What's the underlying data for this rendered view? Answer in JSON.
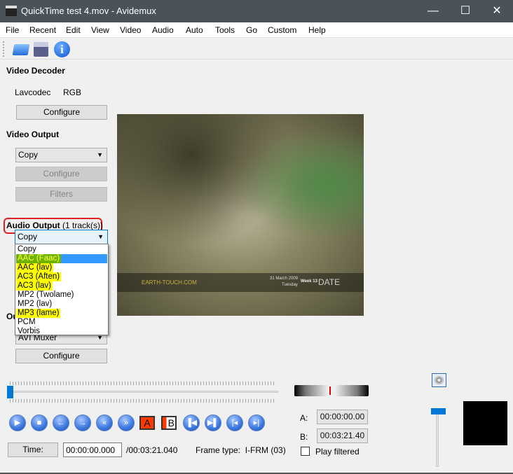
{
  "window": {
    "title": "QuickTime test 4.mov - Avidemux",
    "minimize": "—",
    "maximize": "☐",
    "close": "✕"
  },
  "menu": [
    "File",
    "Recent",
    "Edit",
    "View",
    "Video",
    "Audio",
    "Auto",
    "Tools",
    "Go",
    "Custom",
    "Help"
  ],
  "toolbar": {
    "icons": [
      "open-folder-icon",
      "save-disk-icon",
      "info-icon"
    ]
  },
  "video_decoder": {
    "heading": "Video Decoder",
    "codec": "Lavcodec",
    "format": "RGB",
    "configure": "Configure"
  },
  "video_output": {
    "heading": "Video Output",
    "selected": "Copy",
    "configure": "Configure",
    "filters": "Filters"
  },
  "audio_output": {
    "heading": "Audio Output",
    "tracks": "(1 track(s))",
    "selected": "Copy",
    "options": [
      "Copy",
      "AAC (Faac)",
      "AAC (lav)",
      "AC3 (Aften)",
      "AC3 (lav)",
      "MP2 (Twolame)",
      "MP2 (lav)",
      "MP3 (lame)",
      "PCM",
      "Vorbis"
    ],
    "highlighted_index": 1,
    "yellow_marked": [
      1,
      2,
      3,
      4,
      7
    ]
  },
  "output_format": {
    "heading_visible": "Ou",
    "selected": "AVI Muxer",
    "configure": "Configure"
  },
  "video_overlay": {
    "brand": "EARTH-TOUCH.COM",
    "date": "31 March 2009",
    "day": "Tuesday",
    "week": "Week 13",
    "label": "DATE"
  },
  "playback": {
    "buttons": [
      "play",
      "stop",
      "previous-frame",
      "next-frame",
      "rewind",
      "fast-forward",
      "set-marker-a",
      "set-marker-b",
      "go-marker-a",
      "go-marker-b",
      "previous-keyframe",
      "next-keyframe"
    ],
    "marker_a": "A",
    "marker_b": "B",
    "position_percent": 0
  },
  "time": {
    "button": "Time:",
    "current": "00:00:00.000",
    "total": "/00:03:21.040",
    "frame_type_label": "Frame type:",
    "frame_type": "I-FRM (03)"
  },
  "markers": {
    "a_label": "A:",
    "a_value": "00:00:00.00",
    "b_label": "B:",
    "b_value": "00:03:21.40"
  },
  "play_filtered": {
    "label": "Play filtered",
    "checked": false
  },
  "volume": {
    "level_percent": 100
  },
  "colors": {
    "titlebar": "#4b535a",
    "selection": "#3399ff",
    "highlight": "#ffff00",
    "annotation": "#e02020"
  }
}
